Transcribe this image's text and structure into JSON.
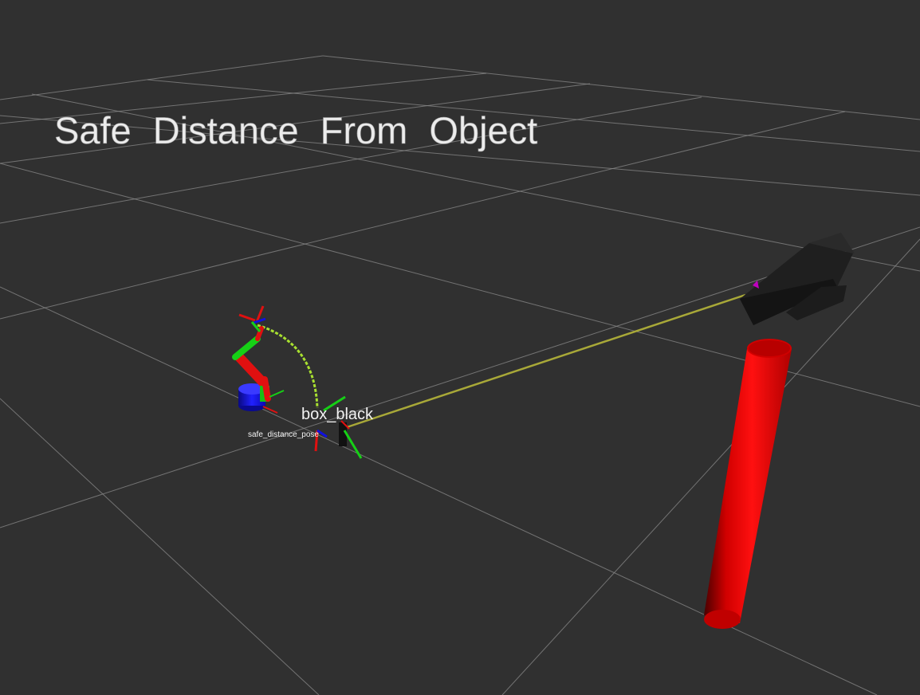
{
  "scene": {
    "background_color": "#303030",
    "grid_color": "#8a8a8a",
    "title": "Safe   Distance   From   Object",
    "markers": {
      "box_label": "box_black",
      "pose_label": "safe_distance_pose"
    },
    "colors": {
      "axis_x": "#e01010",
      "axis_y": "#16d016",
      "axis_z": "#1010e0",
      "robot_base": "#1a1ae0",
      "cylinder": "#e00000",
      "trajectory": "#a8e030",
      "distance_line": "#a8a838",
      "box_object": "#1e1e1e"
    }
  }
}
